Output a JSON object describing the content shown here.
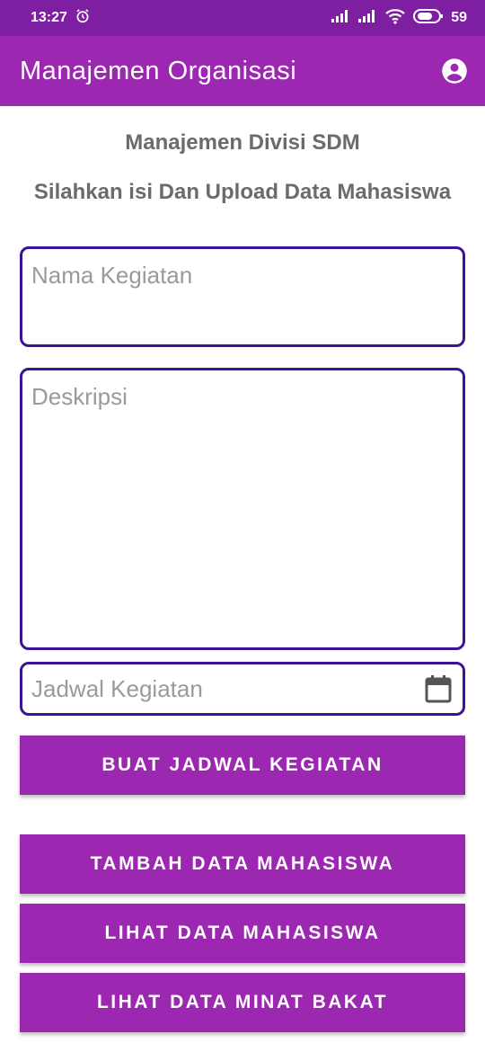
{
  "status_bar": {
    "time": "13:27",
    "battery": "59",
    "icons": [
      "alarm-icon",
      "signal-icon",
      "signal-icon",
      "wifi-icon",
      "battery-icon"
    ]
  },
  "app_bar": {
    "title": "Manajemen Organisasi",
    "account_icon": "account-circle-icon"
  },
  "headings": {
    "title": "Manajemen Divisi SDM",
    "subtitle": "Silahkan isi Dan Upload Data Mahasiswa"
  },
  "form": {
    "name_placeholder": "Nama Kegiatan",
    "name_value": "",
    "description_placeholder": "Deskripsi",
    "description_value": "",
    "schedule_placeholder": "Jadwal Kegiatan",
    "schedule_value": "",
    "schedule_icon": "calendar-icon"
  },
  "buttons": {
    "create_schedule": "BUAT JADWAL KEGIATAN",
    "add_student": "TAMBAH DATA MAHASISWA",
    "view_students": "LIHAT DATA MAHASISWA",
    "view_interests": "LIHAT DATA MINAT BAKAT"
  },
  "colors": {
    "status_bar": "#7e1ea0",
    "app_bar": "#9c27b0",
    "button": "#9c27b0",
    "field_border": "#3b1396",
    "heading_text": "#6b6b6b"
  }
}
